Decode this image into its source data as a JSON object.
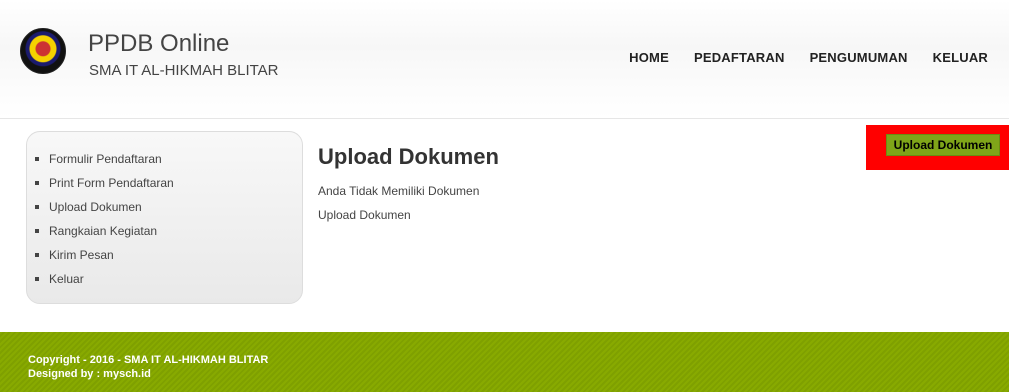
{
  "header": {
    "logo_icon": "school-crest-logo",
    "title": "PPDB Online",
    "subtitle": "SMA IT AL-HIKMAH BLITAR",
    "nav": [
      "HOME",
      "PEDAFTARAN",
      "PENGUMUMAN",
      "KELUAR"
    ]
  },
  "sidebar": {
    "items": [
      "Formulir Pendaftaran",
      "Print Form Pendaftaran",
      "Upload Dokumen",
      "Rangkaian Kegiatan",
      "Kirim Pesan",
      "Keluar"
    ]
  },
  "main": {
    "title": "Upload Dokumen",
    "message": "Anda Tidak Memiliki Dokumen",
    "upload_link": "Upload Dokumen",
    "upload_button": "Upload Dokumen"
  },
  "footer": {
    "copyright": "Copyright - 2016 - SMA IT AL-HIKMAH BLITAR",
    "designed_by": "Designed by : mysch.id"
  },
  "colors": {
    "accent_green": "#7fa519",
    "highlight_red": "#ff0000"
  }
}
